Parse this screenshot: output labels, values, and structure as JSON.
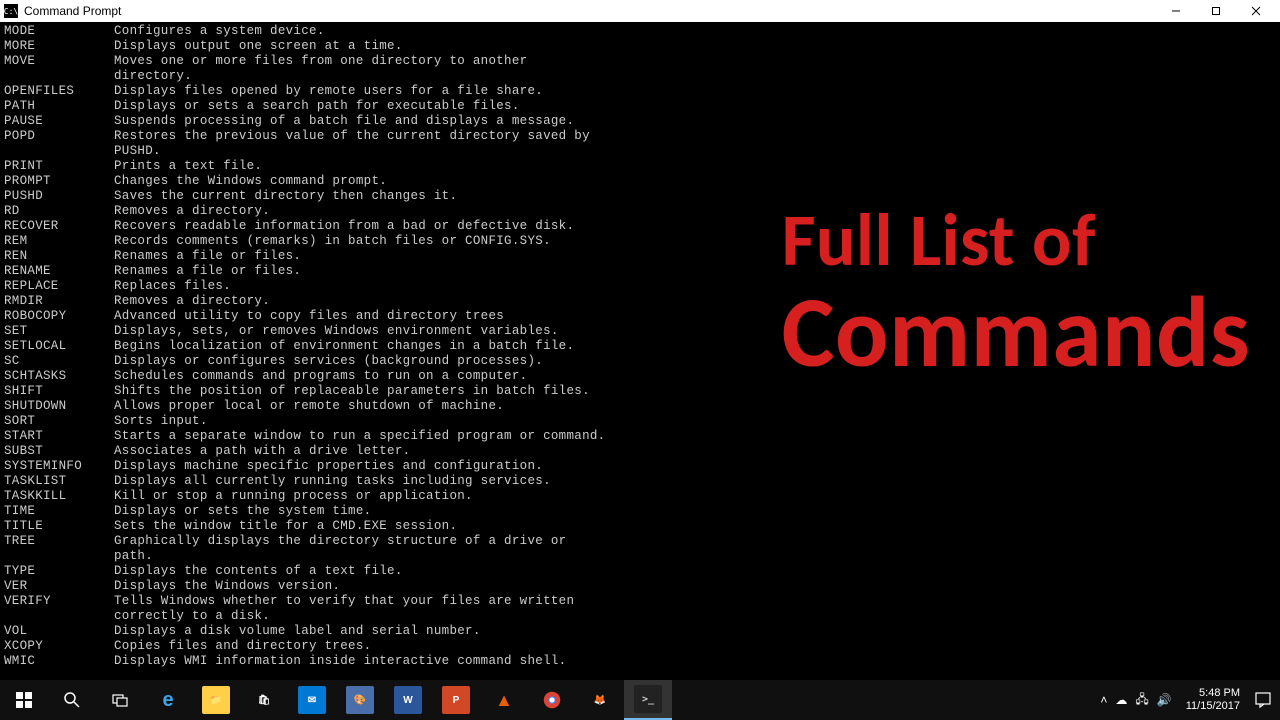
{
  "window": {
    "title": "Command Prompt"
  },
  "overlay": {
    "line1": "Full List of",
    "line2": "Commands"
  },
  "commands": [
    {
      "name": "MODE",
      "desc": "Configures a system device."
    },
    {
      "name": "MORE",
      "desc": "Displays output one screen at a time."
    },
    {
      "name": "MOVE",
      "desc": "Moves one or more files from one directory to another",
      "cont": "directory."
    },
    {
      "name": "OPENFILES",
      "desc": "Displays files opened by remote users for a file share."
    },
    {
      "name": "PATH",
      "desc": "Displays or sets a search path for executable files."
    },
    {
      "name": "PAUSE",
      "desc": "Suspends processing of a batch file and displays a message."
    },
    {
      "name": "POPD",
      "desc": "Restores the previous value of the current directory saved by",
      "cont": "PUSHD."
    },
    {
      "name": "PRINT",
      "desc": "Prints a text file."
    },
    {
      "name": "PROMPT",
      "desc": "Changes the Windows command prompt."
    },
    {
      "name": "PUSHD",
      "desc": "Saves the current directory then changes it."
    },
    {
      "name": "RD",
      "desc": "Removes a directory."
    },
    {
      "name": "RECOVER",
      "desc": "Recovers readable information from a bad or defective disk."
    },
    {
      "name": "REM",
      "desc": "Records comments (remarks) in batch files or CONFIG.SYS."
    },
    {
      "name": "REN",
      "desc": "Renames a file or files."
    },
    {
      "name": "RENAME",
      "desc": "Renames a file or files."
    },
    {
      "name": "REPLACE",
      "desc": "Replaces files."
    },
    {
      "name": "RMDIR",
      "desc": "Removes a directory."
    },
    {
      "name": "ROBOCOPY",
      "desc": "Advanced utility to copy files and directory trees"
    },
    {
      "name": "SET",
      "desc": "Displays, sets, or removes Windows environment variables."
    },
    {
      "name": "SETLOCAL",
      "desc": "Begins localization of environment changes in a batch file."
    },
    {
      "name": "SC",
      "desc": "Displays or configures services (background processes)."
    },
    {
      "name": "SCHTASKS",
      "desc": "Schedules commands and programs to run on a computer."
    },
    {
      "name": "SHIFT",
      "desc": "Shifts the position of replaceable parameters in batch files."
    },
    {
      "name": "SHUTDOWN",
      "desc": "Allows proper local or remote shutdown of machine."
    },
    {
      "name": "SORT",
      "desc": "Sorts input."
    },
    {
      "name": "START",
      "desc": "Starts a separate window to run a specified program or command."
    },
    {
      "name": "SUBST",
      "desc": "Associates a path with a drive letter."
    },
    {
      "name": "SYSTEMINFO",
      "desc": "Displays machine specific properties and configuration."
    },
    {
      "name": "TASKLIST",
      "desc": "Displays all currently running tasks including services."
    },
    {
      "name": "TASKKILL",
      "desc": "Kill or stop a running process or application."
    },
    {
      "name": "TIME",
      "desc": "Displays or sets the system time."
    },
    {
      "name": "TITLE",
      "desc": "Sets the window title for a CMD.EXE session."
    },
    {
      "name": "TREE",
      "desc": "Graphically displays the directory structure of a drive or",
      "cont": "path."
    },
    {
      "name": "TYPE",
      "desc": "Displays the contents of a text file."
    },
    {
      "name": "VER",
      "desc": "Displays the Windows version."
    },
    {
      "name": "VERIFY",
      "desc": "Tells Windows whether to verify that your files are written",
      "cont": "correctly to a disk."
    },
    {
      "name": "VOL",
      "desc": "Displays a disk volume label and serial number."
    },
    {
      "name": "XCOPY",
      "desc": "Copies files and directory trees."
    },
    {
      "name": "WMIC",
      "desc": "Displays WMI information inside interactive command shell."
    }
  ],
  "taskbar": {
    "time": "5:48 PM",
    "date": "11/15/2017"
  }
}
